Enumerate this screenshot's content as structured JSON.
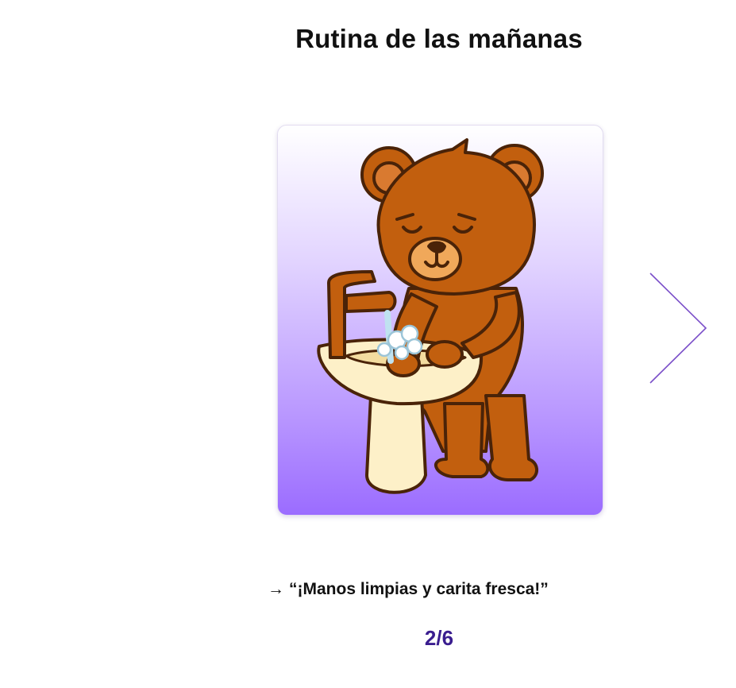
{
  "title": "Rutina de las mañanas",
  "card": {
    "illustration_icon": "bear-washing-hands-illustration",
    "gradient_top": "#ffffff",
    "gradient_bottom": "#9b6cff"
  },
  "navigation": {
    "next_icon": "chevron-right-icon",
    "arrow_color": "#7b4fc9"
  },
  "caption": {
    "arrow_glyph": "→",
    "text": "“¡Manos limpias y carita fresca!”"
  },
  "counter": {
    "text": "2/6",
    "color": "#3a1d8f"
  }
}
